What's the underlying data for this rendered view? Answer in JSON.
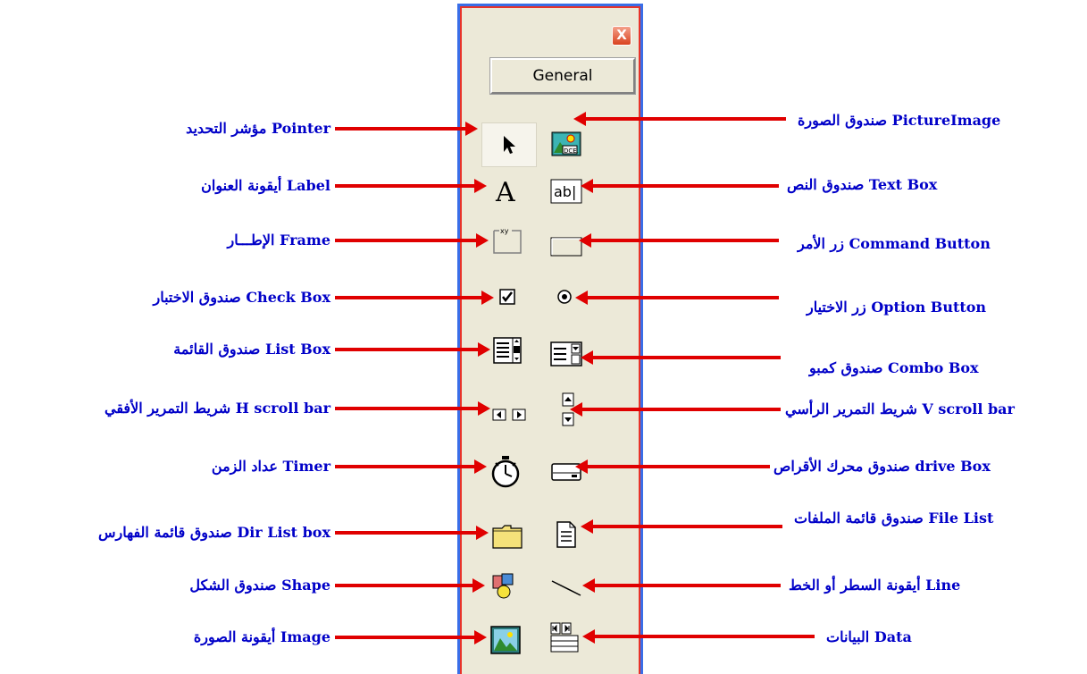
{
  "toolbox": {
    "close_icon": "X",
    "general_label": "General"
  },
  "left_labels": [
    "مؤشر التحديد    Pointer",
    "أيقونة العنوان    Label",
    "الإطـــار Frame",
    "صندوق الاختبار Check Box",
    "صندوق القائمة   List Box",
    "شريط التمرير الأفقي H scroll bar",
    "عداد الزمن    Timer",
    "صندوق قائمة الفهارس Dir List box",
    "صندوق الشكل    Shape",
    "أيقونة الصورة   Image"
  ],
  "right_labels": [
    "صندوق الصورة PictureImage",
    "صندوق النص Text Box",
    "زر الأمر Command Button",
    "زر الاختيار Option Button",
    "صندوق كمبو Combo Box",
    "شريط التمرير الرأسي V scroll bar",
    "صندوق محرك الأقراص drive Box",
    "صندوق قائمة الملفات File List",
    "أيقونة السطر أو الخط    Line",
    "البيانات   Data"
  ],
  "colors": {
    "label": "#0000c8",
    "arrow": "#e00000",
    "frame": "#3a6ee8",
    "panel": "#ece9d8"
  }
}
